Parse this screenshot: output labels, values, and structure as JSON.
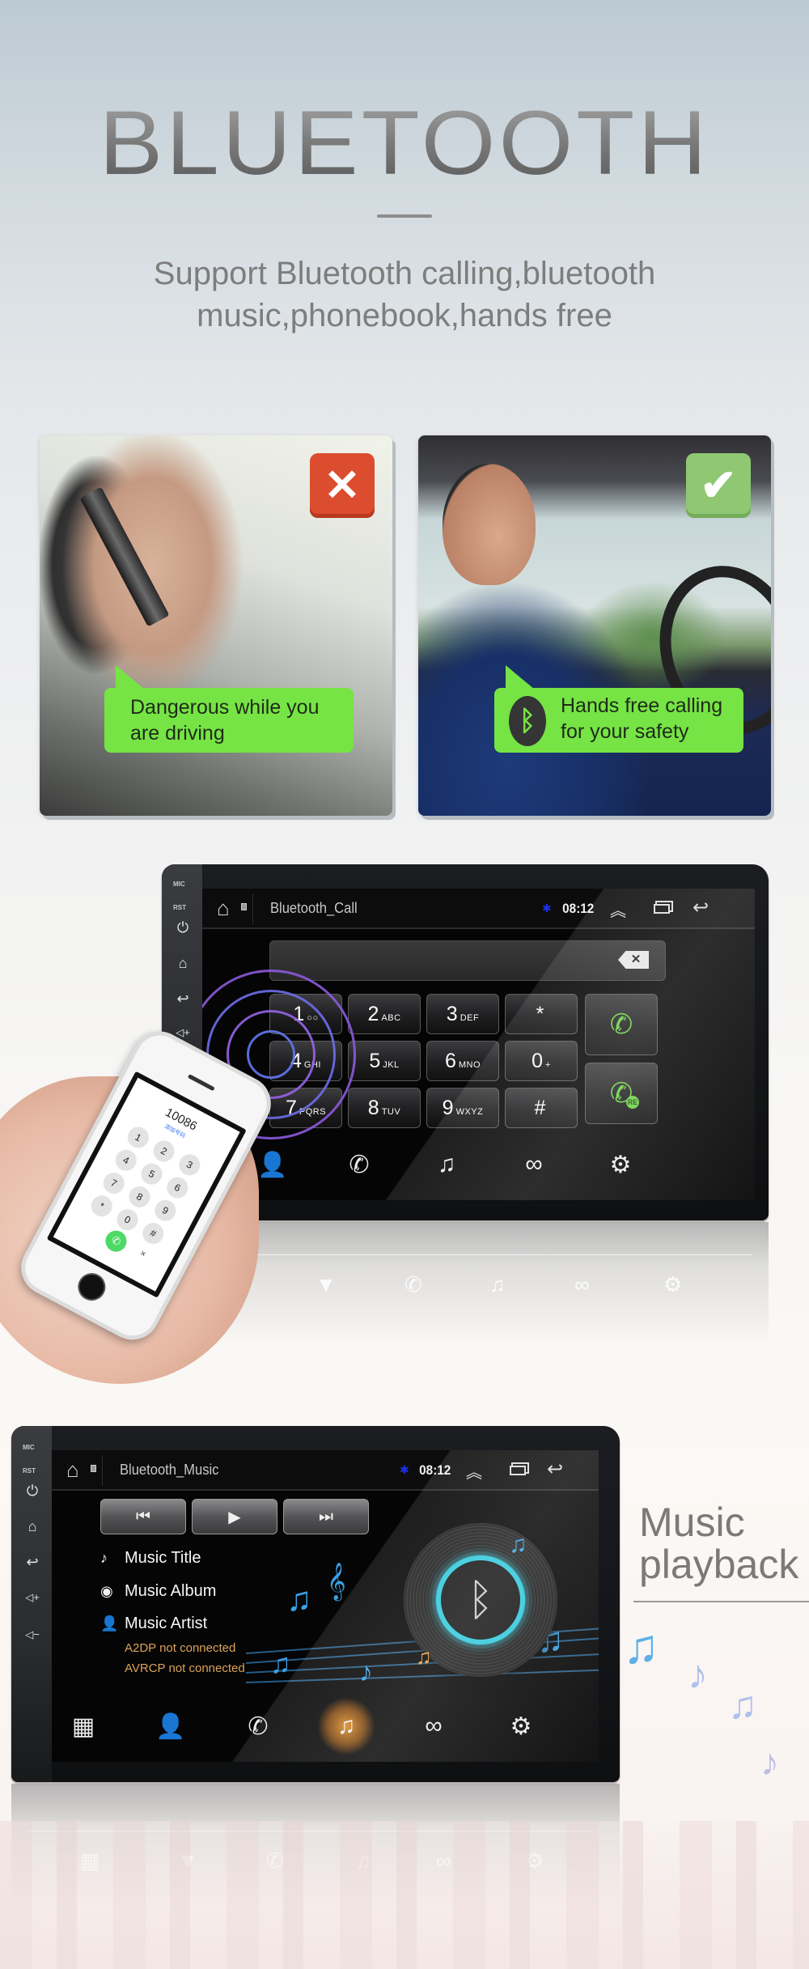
{
  "hero": {
    "title": "BLUETOOTH",
    "subtitle_line1": "Support Bluetooth calling,bluetooth",
    "subtitle_line2": "music,phonebook,hands free"
  },
  "comparison": {
    "bad": {
      "badge_icon": "close-icon",
      "badge_glyph": "✕",
      "badge_color": "#dc4c2f",
      "caption_line1": "Dangerous while you",
      "caption_line2": "are driving"
    },
    "good": {
      "badge_icon": "checkmark-icon",
      "badge_glyph": "✔",
      "badge_color": "#8fc772",
      "bt_glyph": "ᛒ",
      "caption_line1": "Hands free calling",
      "caption_line2": "for your safety"
    },
    "bubble_color": "#76e444"
  },
  "side_panel": {
    "mic": "MIC",
    "rst": "RST",
    "power_glyph": "⏻",
    "home_glyph": "⌂",
    "back_glyph": "↩",
    "vol_up_glyph": "◁+",
    "vol_down_glyph": "◁−"
  },
  "statusbar": {
    "home_glyph": "⌂",
    "bt_glyph": "✱",
    "time": "08:12",
    "chevron_glyph": "︽",
    "back_glyph": "↩"
  },
  "call_screen": {
    "title": "Bluetooth_Call",
    "backspace_glyph": "✕",
    "keys": [
      {
        "num": "1",
        "sub": "○○"
      },
      {
        "num": "2",
        "sub": "ABC"
      },
      {
        "num": "3",
        "sub": "DEF"
      },
      {
        "num": "*",
        "sub": ""
      },
      {
        "num": "4",
        "sub": "GHI"
      },
      {
        "num": "5",
        "sub": "JKL"
      },
      {
        "num": "6",
        "sub": "MNO"
      },
      {
        "num": "0",
        "sub": "+"
      },
      {
        "num": "7",
        "sub": "PQRS"
      },
      {
        "num": "8",
        "sub": "TUV"
      },
      {
        "num": "9",
        "sub": "WXYZ"
      },
      {
        "num": "#",
        "sub": ""
      }
    ],
    "call_glyph": "✆",
    "redial_glyph": "✆",
    "redial_badge": "RE",
    "nav": [
      {
        "name": "contacts",
        "glyph": "👤"
      },
      {
        "name": "call-log",
        "glyph": "✆"
      },
      {
        "name": "music",
        "glyph": "♫"
      },
      {
        "name": "link",
        "glyph": "∞"
      },
      {
        "name": "settings",
        "glyph": "⚙"
      }
    ]
  },
  "phone": {
    "dialed_number": "10086",
    "add_number_label": "添加号码",
    "keys": [
      "1",
      "2",
      "3",
      "4",
      "5",
      "6",
      "7",
      "8",
      "9",
      "*",
      "0",
      "#"
    ],
    "call_glyph": "✆",
    "delete_glyph": "✕"
  },
  "music_screen": {
    "title": "Bluetooth_Music",
    "controls": [
      {
        "name": "previous",
        "glyph": "⏮"
      },
      {
        "name": "play",
        "glyph": "▶"
      },
      {
        "name": "next",
        "glyph": "⏭"
      }
    ],
    "info": [
      {
        "icon": "music-note-icon",
        "glyph": "♪",
        "label": "Music Title"
      },
      {
        "icon": "album-icon",
        "glyph": "◉",
        "label": "Music Album"
      },
      {
        "icon": "artist-icon",
        "glyph": "👤",
        "label": "Music Artist"
      }
    ],
    "status": [
      "A2DP not connected",
      "AVRCP not connected"
    ],
    "status_color": "#dca25a",
    "disc_glyph": "ᛒ",
    "disc_ring_color": "#2ec9dc",
    "nav": [
      {
        "name": "dialpad",
        "glyph": "▦"
      },
      {
        "name": "contacts",
        "glyph": "👤"
      },
      {
        "name": "call-log",
        "glyph": "✆"
      },
      {
        "name": "music",
        "glyph": "♫"
      },
      {
        "name": "link",
        "glyph": "∞"
      },
      {
        "name": "settings",
        "glyph": "⚙"
      }
    ],
    "active_nav": "music"
  },
  "music_heading": {
    "line1": "Music",
    "line2": "playback"
  }
}
